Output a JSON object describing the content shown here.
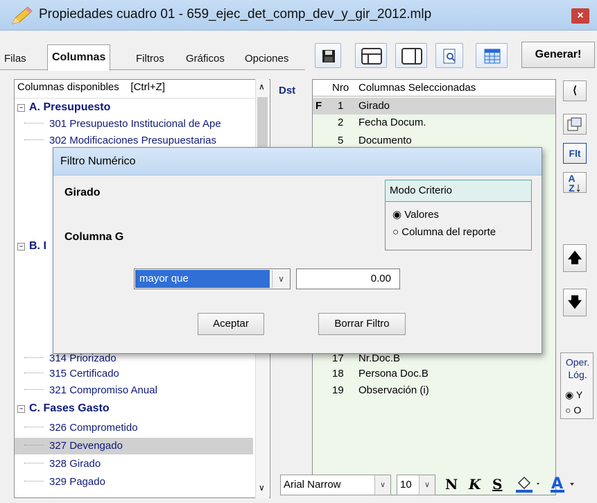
{
  "window": {
    "title": "Propiedades cuadro 01 - 659_ejec_det_comp_dev_y_gir_2012.mlp",
    "close": "×"
  },
  "tabs": [
    "Filas",
    "Columnas",
    "Filtros",
    "Gráficos",
    "Opciones"
  ],
  "toolbar": {
    "generate_label": "Generar!"
  },
  "left_panel": {
    "header": "Columnas disponibles",
    "shortcut": "[Ctrl+Z]",
    "groups": [
      {
        "label": "A. Presupuesto",
        "items": [
          "301 Presupuesto Institucional de Ape",
          "302 Modificaciones Presupuestarias"
        ]
      },
      {
        "label": "B. I"
      },
      {
        "label": "C. Fases Gasto",
        "items": [
          "326 Comprometido",
          "327 Devengado",
          "328 Girado",
          "329 Pagado"
        ]
      }
    ],
    "mid_items": [
      "315 Certificado",
      "321 Compromiso Anual"
    ],
    "partial_item": "314 Priorizado"
  },
  "right_panel": {
    "dst_label": "Dst",
    "columns": {
      "nro": "Nro",
      "name": "Columnas Seleccionadas"
    },
    "rows": [
      {
        "flag": "F",
        "nro": "1",
        "name": "Girado"
      },
      {
        "flag": "",
        "nro": "2",
        "name": "Fecha Docum."
      },
      {
        "flag": "",
        "nro": "5",
        "name": "Documento"
      },
      {
        "flag": "",
        "nro": "17",
        "name": "Nr.Doc.B"
      },
      {
        "flag": "",
        "nro": "18",
        "name": "Persona Doc.B"
      },
      {
        "flag": "",
        "nro": "19",
        "name": "Observación (i)"
      }
    ]
  },
  "side": {
    "flt_label": "Flt",
    "oper_label": "Oper. Lóg.",
    "oper_options": [
      "Y",
      "O"
    ]
  },
  "bottom": {
    "font_name": "Arial Narrow",
    "font_size": "10",
    "bold": "N",
    "italic": "K",
    "underline": "S"
  },
  "dialog": {
    "title": "Filtro Numérico",
    "field_label": "Girado",
    "column_label": "Columna G",
    "mode_title": "Modo Criterio",
    "mode_options": [
      "Valores",
      "Columna del reporte"
    ],
    "operator": "mayor que",
    "value": "0.00",
    "accept": "Aceptar",
    "clear": "Borrar Filtro"
  }
}
